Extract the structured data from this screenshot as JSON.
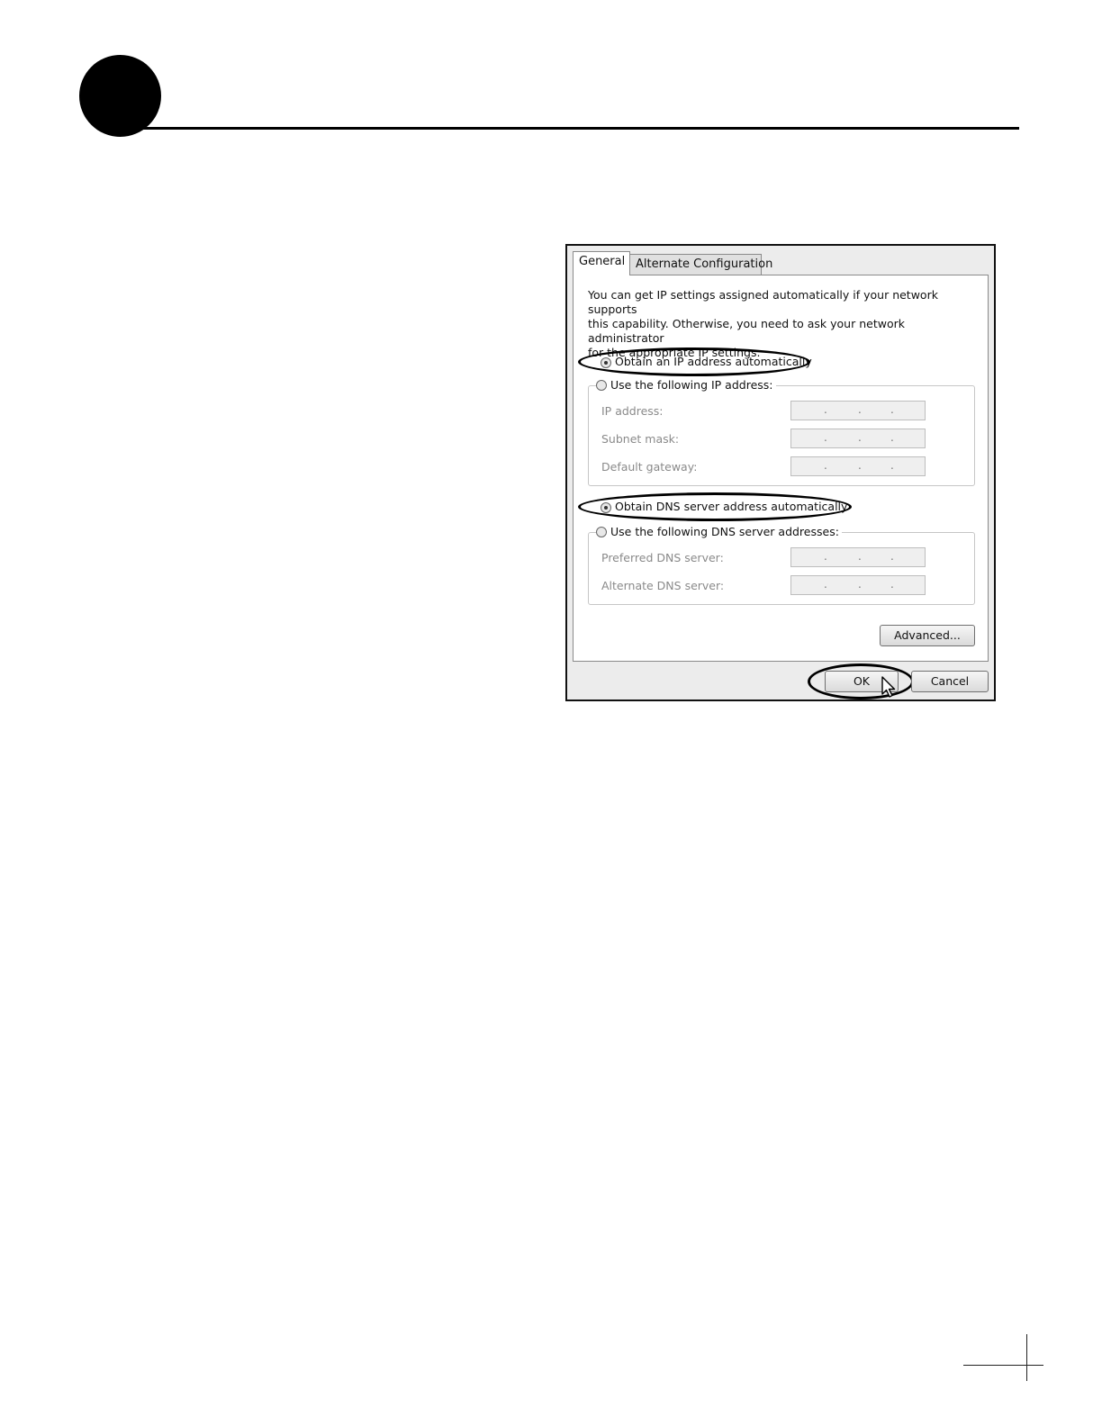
{
  "dialog": {
    "tabs": [
      {
        "label": "General"
      },
      {
        "label": "Alternate Configuration"
      }
    ],
    "intro_lines": [
      "You can get IP settings assigned automatically if your network supports",
      "this capability. Otherwise, you need to ask your network administrator",
      "for the appropriate IP settings."
    ],
    "ip_options": {
      "auto_label": "Obtain an IP address automatically",
      "manual_label": "Use the following IP address:",
      "selected": "auto"
    },
    "ip_fields": [
      {
        "label": "IP address:",
        "value": ""
      },
      {
        "label": "Subnet mask:",
        "value": ""
      },
      {
        "label": "Default gateway:",
        "value": ""
      }
    ],
    "dns_options": {
      "auto_label": "Obtain DNS server address automatically",
      "manual_label": "Use the following DNS server addresses:",
      "selected": "auto"
    },
    "dns_fields": [
      {
        "label": "Preferred DNS server:",
        "value": ""
      },
      {
        "label": "Alternate DNS server:",
        "value": ""
      }
    ],
    "buttons": {
      "advanced": "Advanced...",
      "ok": "OK",
      "cancel": "Cancel"
    },
    "ip_separator": "."
  }
}
